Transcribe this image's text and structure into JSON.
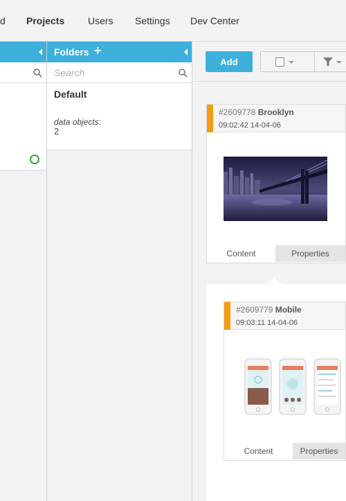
{
  "nav": {
    "items": [
      {
        "label": "d",
        "active": false
      },
      {
        "label": "Projects",
        "active": true
      },
      {
        "label": "Users",
        "active": false
      },
      {
        "label": "Settings",
        "active": false
      },
      {
        "label": "Dev Center",
        "active": false
      }
    ]
  },
  "folders": {
    "title": "Folders",
    "add_icon": "+",
    "search_placeholder": "Search",
    "items": [
      {
        "name": "Default",
        "meta_label": "data objects:",
        "meta_value": "2"
      }
    ]
  },
  "toolbar": {
    "add_label": "Add"
  },
  "objects": [
    {
      "id": "#2609778",
      "name": "Brooklyn",
      "time": "09:02:42 14-04-06",
      "tabs": [
        "Content",
        "Properties"
      ],
      "image": "night-bridge-photo"
    },
    {
      "id": "#2609779",
      "name": "Mobile",
      "time": "09:03:11 14-04-06",
      "tabs": [
        "Content",
        "Properties"
      ],
      "image": "mobile-app-screens"
    }
  ],
  "colors": {
    "accent": "#3db0dd",
    "flag": "#f39c12",
    "status_ok": "#3aa63a"
  }
}
